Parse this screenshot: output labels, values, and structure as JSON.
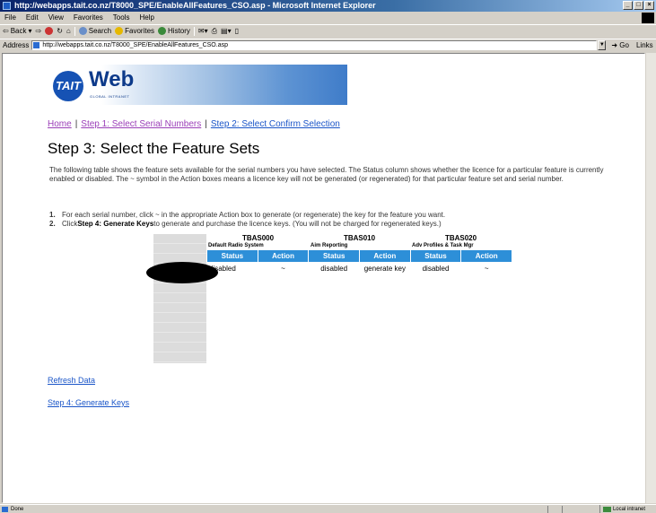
{
  "window": {
    "title": "http://webapps.tait.co.nz/T8000_SPE/EnableAllFeatures_CSO.asp - Microsoft Internet Explorer"
  },
  "menu": [
    "File",
    "Edit",
    "View",
    "Favorites",
    "Tools",
    "Help"
  ],
  "toolbar": {
    "back": "Back",
    "search": "Search",
    "favorites": "Favorites",
    "history": "History"
  },
  "address": {
    "label": "Address",
    "url": "http://webapps.tait.co.nz/T8000_SPE/EnableAllFeatures_CSO.asp",
    "go": "Go",
    "links": "Links"
  },
  "banner": {
    "logo_mark": "TAIT",
    "logo_word": "Web",
    "logo_sub": "GLOBAL INTRANET"
  },
  "breadcrumb": {
    "home": "Home",
    "step1": "Step 1: Select Serial Numbers",
    "step2": "Step 2: Select Confirm Selection",
    "sep": "|"
  },
  "page": {
    "title": "Step 3: Select the Feature Sets",
    "intro": "The following table shows the feature sets available for the serial numbers you have selected. The Status column shows whether the licence for a particular feature is currently enabled or disabled. The ~ symbol in the Action boxes means a licence key will not be generated (or regenerated) for that particular feature set and serial number.",
    "step_1_num": "1.",
    "step_1_text": "For each serial number, click ~ in the appropriate Action box to generate (or regenerate) the key for the feature you want.",
    "step_2_num": "2.",
    "step_2_pre": "Click ",
    "step_2_bold": "Step 4: Generate Keys",
    "step_2_post": " to generate and purchase the licence keys. (You will not be charged for regenerated keys.)"
  },
  "table": {
    "groups": [
      {
        "code": "TBAS000",
        "name": "Default Radio System"
      },
      {
        "code": "TBAS010",
        "name": "Aim Reporting"
      },
      {
        "code": "TBAS020",
        "name": "Adv Profiles & Task Mgr"
      }
    ],
    "headers": [
      "Status",
      "Action",
      "Status",
      "Action",
      "Status",
      "Action"
    ],
    "row": [
      "disabled",
      "~",
      "disabled",
      "generate key",
      "disabled",
      "~"
    ]
  },
  "links": {
    "refresh": "Refresh Data",
    "generate": "Step 4: Generate Keys"
  },
  "status": {
    "left": "Done",
    "zone": "Local intranet"
  },
  "colors": {
    "header_blue": "#2d8fd8",
    "link_blue": "#1a55c8",
    "visited_purple": "#9b3fb8"
  }
}
